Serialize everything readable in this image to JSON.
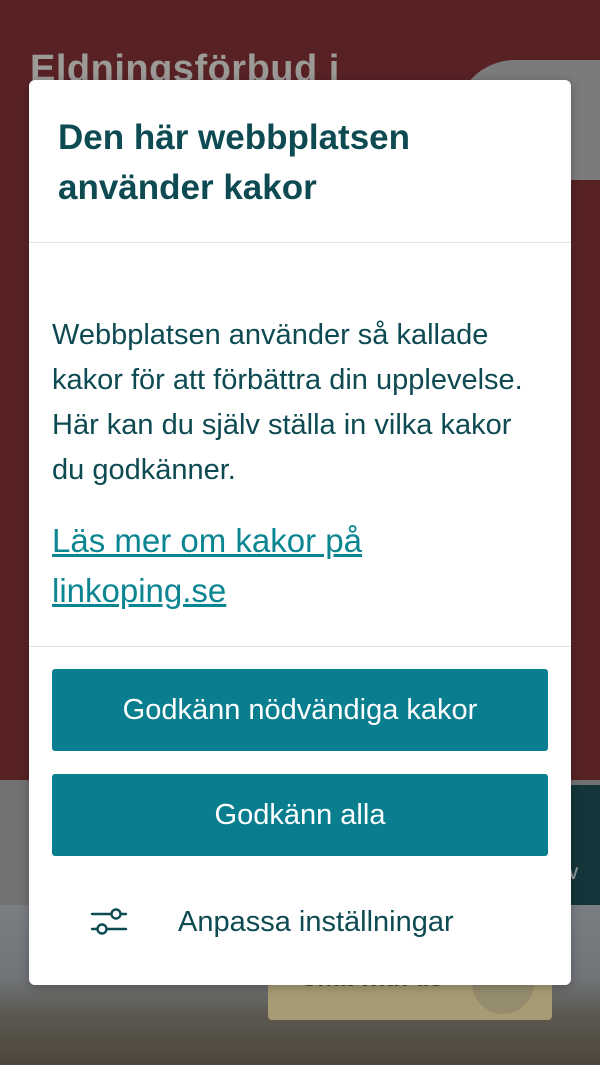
{
  "background": {
    "heading": "Eldningsförbud i",
    "chat_label": "Chat with us"
  },
  "cookie_dialog": {
    "title": "Den här webbplatsen använder kakor",
    "body": "Webbplatsen använder så kallade kakor för att förbättra din upplevelse. Här kan du själv ställa in vilka kakor du godkänner.",
    "link": "Läs mer om kakor på linkoping.se",
    "accept_necessary_label": "Godkänn nödvändiga kakor",
    "accept_all_label": "Godkänn alla",
    "customize_label": "Anpassa inställningar",
    "customize_icon": "sliders-icon"
  },
  "colors": {
    "banner": "#6b2125",
    "primary_button": "#087e8e",
    "text": "#0d4a52",
    "link": "#0b8592"
  }
}
